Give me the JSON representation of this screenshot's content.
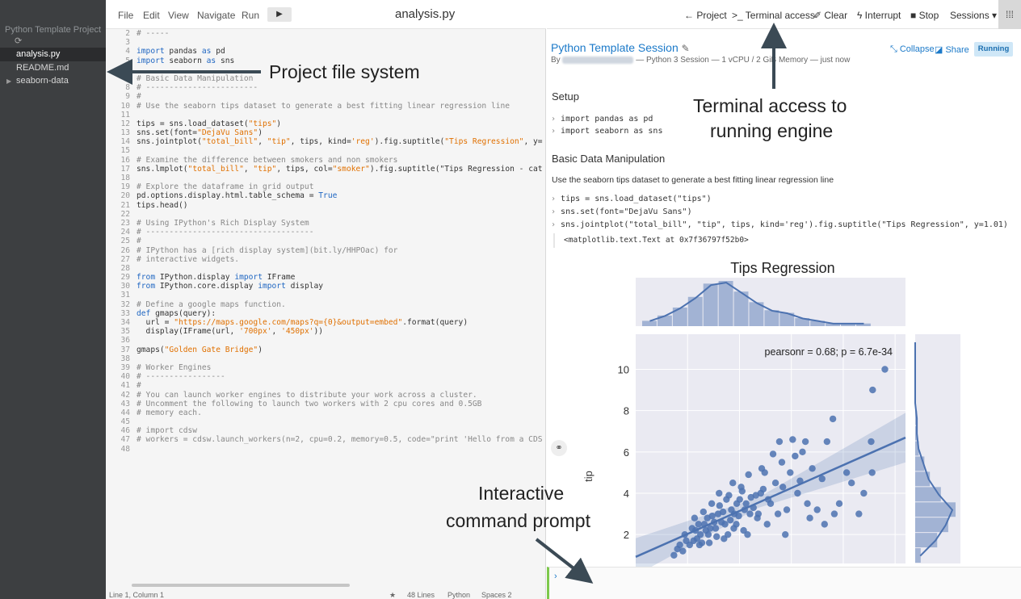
{
  "sidebar": {
    "project_title": "Python Template Project",
    "refresh_icon": "⟳",
    "files": [
      {
        "label": "analysis.py",
        "active": true,
        "folder": false
      },
      {
        "label": "README.md",
        "active": false,
        "folder": false
      },
      {
        "label": "seaborn-data",
        "active": false,
        "folder": true
      }
    ]
  },
  "editor": {
    "menus": [
      "File",
      "Edit",
      "View",
      "Navigate",
      "Run"
    ],
    "run_icon": "▶",
    "file_title": "analysis.py",
    "lines": [
      [
        "2",
        "# -----"
      ],
      [
        "3",
        ""
      ],
      [
        "4",
        "import pandas as pd"
      ],
      [
        "5",
        "import seaborn as sns"
      ],
      [
        "6",
        ""
      ],
      [
        "7",
        "# Basic Data Manipulation"
      ],
      [
        "8",
        "# ------------------------"
      ],
      [
        "9",
        "#"
      ],
      [
        "10",
        "# Use the seaborn tips dataset to generate a best fitting linear regression line"
      ],
      [
        "11",
        ""
      ],
      [
        "12",
        "tips = sns.load_dataset(\"tips\")"
      ],
      [
        "13",
        "sns.set(font=\"DejaVu Sans\")"
      ],
      [
        "14",
        "sns.jointplot(\"total_bill\", \"tip\", tips, kind='reg').fig.suptitle(\"Tips Regression\", y="
      ],
      [
        "15",
        ""
      ],
      [
        "16",
        "# Examine the difference between smokers and non smokers"
      ],
      [
        "17",
        "sns.lmplot(\"total_bill\", \"tip\", tips, col=\"smoker\").fig.suptitle(\"Tips Regression - cat"
      ],
      [
        "18",
        ""
      ],
      [
        "19",
        "# Explore the dataframe in grid output"
      ],
      [
        "20",
        "pd.options.display.html.table_schema = True"
      ],
      [
        "21",
        "tips.head()"
      ],
      [
        "22",
        ""
      ],
      [
        "23",
        "# Using IPython's Rich Display System"
      ],
      [
        "24",
        "# ------------------------------------"
      ],
      [
        "25",
        "#"
      ],
      [
        "26",
        "# IPython has a [rich display system](bit.ly/HHPOac) for"
      ],
      [
        "27",
        "# interactive widgets."
      ],
      [
        "28",
        ""
      ],
      [
        "29",
        "from IPython.display import IFrame"
      ],
      [
        "30",
        "from IPython.core.display import display"
      ],
      [
        "31",
        ""
      ],
      [
        "32",
        "# Define a google maps function."
      ],
      [
        "33",
        "def gmaps(query):"
      ],
      [
        "34",
        "  url = \"https://maps.google.com/maps?q={0}&output=embed\".format(query)"
      ],
      [
        "35",
        "  display(IFrame(url, '700px', '450px'))"
      ],
      [
        "36",
        ""
      ],
      [
        "37",
        "gmaps(\"Golden Gate Bridge\")"
      ],
      [
        "38",
        ""
      ],
      [
        "39",
        "# Worker Engines"
      ],
      [
        "40",
        "# -----------------"
      ],
      [
        "41",
        "#"
      ],
      [
        "42",
        "# You can launch worker engines to distribute your work across a cluster."
      ],
      [
        "43",
        "# Uncomment the following to launch two workers with 2 cpu cores and 0.5GB"
      ],
      [
        "44",
        "# memory each."
      ],
      [
        "45",
        ""
      ],
      [
        "46",
        "# import cdsw"
      ],
      [
        "47",
        "# workers = cdsw.launch_workers(n=2, cpu=0.2, memory=0.5, code=\"print 'Hello from a CDS"
      ],
      [
        "48",
        ""
      ]
    ],
    "status": {
      "position": "Line 1, Column 1",
      "star": "★",
      "lines": "48 Lines",
      "language": "Python",
      "spaces": "Spaces 2"
    }
  },
  "session": {
    "toolbar": {
      "project": "← Project",
      "terminal": ">_ Terminal access",
      "clear": "✐ Clear",
      "interrupt": "ϟ Interrupt",
      "stop": "■ Stop",
      "sessions": "Sessions ▾",
      "grid_icon": "⁞⁞⁞"
    },
    "title": "Python Template Session",
    "edit_icon": "✎",
    "meta_by": "By",
    "meta_rest": "— Python 3 Session — 1 vCPU / 2 GiB Memory — just now",
    "collapse": "⤡ Collapse",
    "share": "◪ Share",
    "status_badge": "Running",
    "setup_heading": "Setup",
    "setup_code": [
      "import pandas as pd",
      "import seaborn as sns"
    ],
    "basic_heading": "Basic Data Manipulation",
    "basic_desc": "Use the seaborn tips dataset to generate a best fitting linear regression line",
    "basic_code": [
      "tips = sns.load_dataset(\"tips\")",
      "sns.set(font=\"DejaVu Sans\")",
      "sns.jointplot(\"total_bill\", \"tip\", tips, kind='reg').fig.suptitle(\"Tips Regression\", y=1.01)"
    ],
    "output_text": "<matplotlib.text.Text at 0x7f36797f52b0>",
    "link_icon": "⚭",
    "prompt_symbol": "›"
  },
  "annotations": {
    "file_system": "Project file system",
    "terminal_line1": "Terminal access to",
    "terminal_line2": "running engine",
    "prompt_line1": "Interactive",
    "prompt_line2": "command prompt"
  },
  "colors": {
    "accent": "#1c7ac9",
    "sidebar_bg": "#3d3f41",
    "chart_series": "#4c72b0",
    "chart_panel_bg": "#eaeaf2",
    "prompt_bar": "#7dc84b"
  },
  "chart_data": {
    "type": "scatter",
    "title": "Tips Regression",
    "ylabel": "tip",
    "xlabel": "",
    "annotation": "pearsonr = 0.68; p = 6.7e-34",
    "yticks": [
      2,
      4,
      6,
      8,
      10
    ],
    "ylim": [
      0.6,
      11.7
    ],
    "xlim": [
      0,
      55
    ],
    "grid": true,
    "regression": {
      "slope": 0.105,
      "intercept": 0.92
    },
    "points": [
      [
        10.3,
        1.7
      ],
      [
        12.5,
        1.8
      ],
      [
        8.5,
        1.3
      ],
      [
        14.8,
        2.0
      ],
      [
        16.3,
        2.3
      ],
      [
        18.2,
        2.5
      ],
      [
        20.1,
        3.0
      ],
      [
        22.5,
        3.5
      ],
      [
        24.0,
        3.3
      ],
      [
        15.0,
        1.6
      ],
      [
        13.2,
        2.0
      ],
      [
        11.0,
        1.5
      ],
      [
        9.6,
        1.2
      ],
      [
        17.5,
        2.6
      ],
      [
        19.5,
        3.2
      ],
      [
        21.0,
        2.9
      ],
      [
        23.5,
        3.8
      ],
      [
        25.5,
        4.0
      ],
      [
        27.0,
        3.7
      ],
      [
        28.5,
        4.5
      ],
      [
        30.0,
        4.3
      ],
      [
        14.0,
        2.5
      ],
      [
        16.8,
        3.0
      ],
      [
        18.8,
        2.0
      ],
      [
        20.6,
        3.5
      ],
      [
        22.0,
        2.2
      ],
      [
        12.0,
        2.8
      ],
      [
        13.8,
        3.1
      ],
      [
        15.6,
        2.9
      ],
      [
        17.1,
        3.4
      ],
      [
        19.0,
        3.9
      ],
      [
        21.7,
        4.1
      ],
      [
        24.8,
        2.8
      ],
      [
        26.3,
        5.0
      ],
      [
        29.0,
        3.0
      ],
      [
        31.5,
        5.0
      ],
      [
        33.0,
        4.0
      ],
      [
        35.0,
        3.5
      ],
      [
        38.0,
        4.7
      ],
      [
        40.5,
        3.0
      ],
      [
        44.0,
        4.5
      ],
      [
        48.2,
        5.0
      ],
      [
        50.8,
        10.0
      ],
      [
        48.3,
        9.0
      ],
      [
        40.2,
        7.6
      ],
      [
        34.6,
        6.5
      ],
      [
        32.0,
        6.6
      ],
      [
        29.8,
        5.5
      ],
      [
        25.7,
        5.2
      ],
      [
        23.0,
        4.9
      ],
      [
        21.5,
        4.3
      ],
      [
        19.8,
        4.5
      ],
      [
        18.5,
        3.7
      ],
      [
        17.0,
        4.0
      ],
      [
        15.5,
        3.5
      ],
      [
        14.3,
        2.2
      ],
      [
        13.0,
        1.5
      ],
      [
        11.5,
        2.3
      ],
      [
        10.0,
        2.0
      ],
      [
        7.8,
        1.0
      ],
      [
        12.8,
        2.5
      ],
      [
        16.0,
        2.6
      ],
      [
        20.5,
        2.5
      ],
      [
        22.8,
        2.0
      ],
      [
        26.8,
        2.5
      ],
      [
        27.5,
        3.5
      ],
      [
        30.5,
        2.0
      ],
      [
        36.0,
        5.2
      ],
      [
        38.5,
        2.5
      ],
      [
        43.0,
        5.0
      ],
      [
        45.5,
        3.0
      ],
      [
        32.5,
        5.8
      ],
      [
        34.0,
        6.0
      ],
      [
        28.0,
        5.9
      ],
      [
        24.5,
        3.9
      ],
      [
        18.0,
        1.8
      ],
      [
        15.2,
        2.3
      ],
      [
        13.5,
        1.6
      ],
      [
        11.8,
        1.7
      ],
      [
        9.0,
        1.5
      ],
      [
        16.5,
        1.9
      ],
      [
        20.0,
        2.3
      ],
      [
        23.3,
        3.0
      ],
      [
        25.0,
        3.0
      ],
      [
        12.2,
        2.2
      ],
      [
        14.6,
        2.8
      ],
      [
        17.8,
        3.1
      ],
      [
        19.3,
        2.7
      ],
      [
        21.2,
        3.7
      ],
      [
        22.2,
        3.2
      ],
      [
        26.0,
        4.2
      ],
      [
        30.8,
        3.2
      ],
      [
        37.0,
        3.2
      ],
      [
        41.5,
        3.5
      ],
      [
        46.5,
        4.0
      ],
      [
        35.5,
        2.8
      ],
      [
        39.0,
        6.5
      ],
      [
        48.0,
        6.5
      ],
      [
        29.3,
        6.5
      ],
      [
        33.5,
        4.6
      ]
    ],
    "top_hist": [
      2,
      4,
      7,
      11,
      16,
      17,
      13,
      9,
      6,
      5,
      3,
      2,
      1,
      1,
      1
    ],
    "right_hist": [
      3,
      12,
      18,
      22,
      14,
      8,
      5,
      2,
      1,
      1,
      0,
      0
    ]
  }
}
